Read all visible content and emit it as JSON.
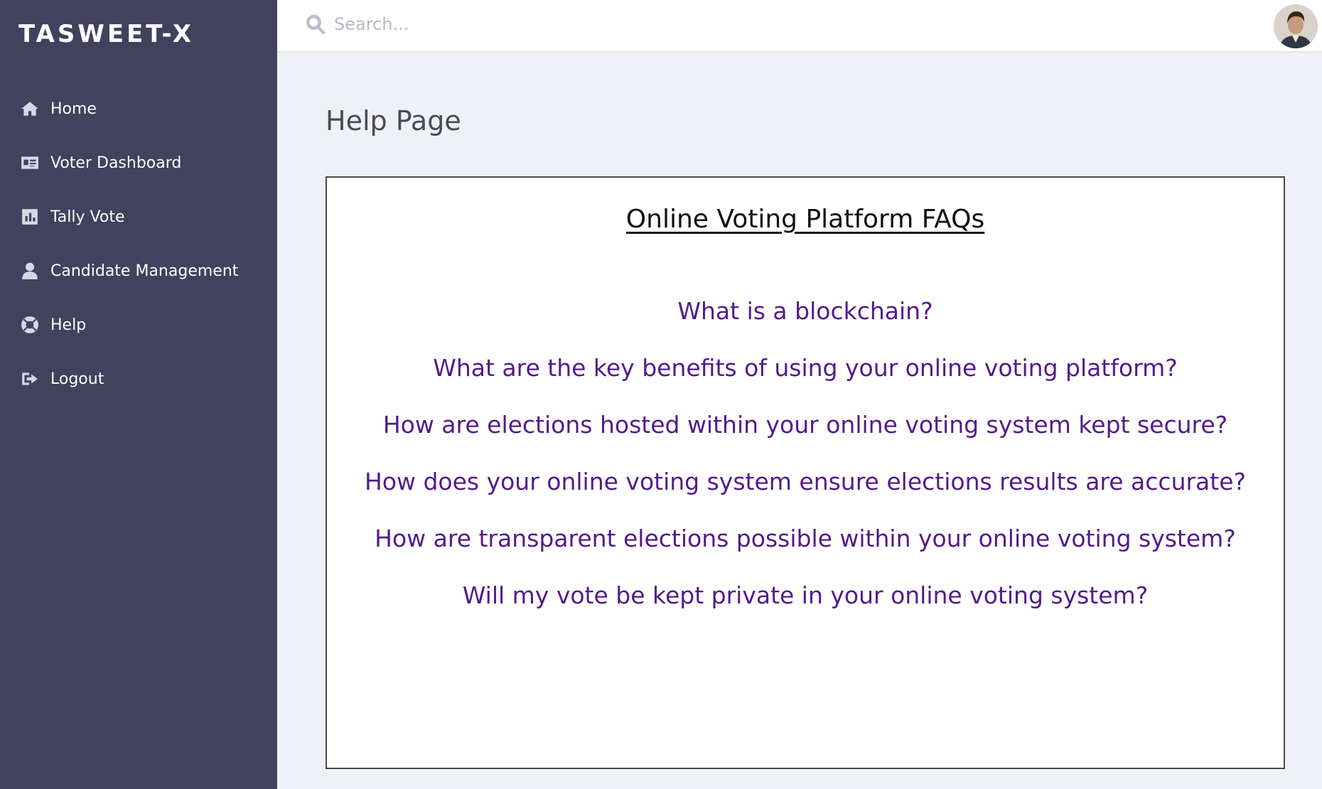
{
  "brand": "TASWEET-X",
  "sidebar": {
    "items": [
      {
        "label": "Home",
        "icon": "home-icon"
      },
      {
        "label": "Voter Dashboard",
        "icon": "id-card-icon"
      },
      {
        "label": "Tally Vote",
        "icon": "bar-chart-icon"
      },
      {
        "label": "Candidate Management",
        "icon": "user-icon"
      },
      {
        "label": "Help",
        "icon": "life-ring-icon"
      },
      {
        "label": "Logout",
        "icon": "sign-out-icon"
      }
    ]
  },
  "header": {
    "search_placeholder": "Search...",
    "search_value": ""
  },
  "main": {
    "page_title": "Help Page",
    "faq_title": "Online Voting Platform FAQs",
    "faqs": [
      "What is a blockchain?",
      "What are the key benefits of using your online voting platform?",
      "How are elections hosted within your online voting system kept secure?",
      "How does your online voting system ensure elections results are accurate?",
      "How are transparent elections possible within your online voting system?",
      "Will my vote be kept private in your online voting system?"
    ]
  },
  "colors": {
    "sidebar_bg": "#42415e",
    "page_bg": "#f0f1f6",
    "faq_link": "#541a8b"
  }
}
